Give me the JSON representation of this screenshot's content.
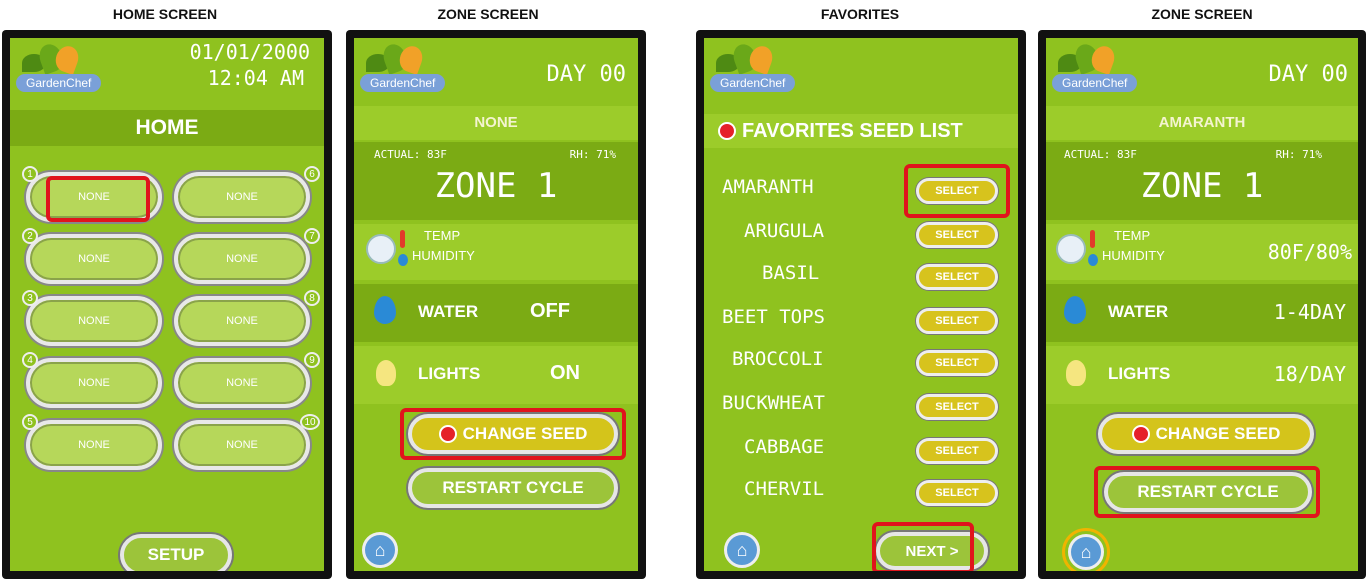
{
  "captions": [
    "HOME SCREEN",
    "ZONE SCREEN",
    "FAVORITES",
    "ZONE SCREEN"
  ],
  "brand": "GardenChef",
  "home": {
    "date": "01/01/2000",
    "time": "12:04 AM",
    "title": "HOME",
    "slots": [
      {
        "num": "1",
        "label": "NONE"
      },
      {
        "num": "6",
        "label": "NONE"
      },
      {
        "num": "2",
        "label": "NONE"
      },
      {
        "num": "7",
        "label": "NONE"
      },
      {
        "num": "3",
        "label": "NONE"
      },
      {
        "num": "8",
        "label": "NONE"
      },
      {
        "num": "4",
        "label": "NONE"
      },
      {
        "num": "9",
        "label": "NONE"
      },
      {
        "num": "5",
        "label": "NONE"
      },
      {
        "num": "10",
        "label": "NONE"
      }
    ],
    "setup": "SETUP"
  },
  "zone1": {
    "day": "DAY 00",
    "seed": "NONE",
    "actual": "ACTUAL: 83F",
    "rh": "RH: 71%",
    "zone": "ZONE 1",
    "temp_label": "TEMP",
    "humidity_label": "HUMIDITY",
    "temp_humidity_value": "",
    "water_label": "WATER",
    "water_value": "OFF",
    "lights_label": "LIGHTS",
    "lights_value": "ON",
    "change_seed": "CHANGE SEED",
    "restart_cycle": "RESTART CYCLE"
  },
  "favorites": {
    "title": "FAVORITES SEED LIST",
    "seeds": [
      "AMARANTH",
      "ARUGULA",
      "BASIL",
      "BEET TOPS",
      "BROCCOLI",
      "BUCKWHEAT",
      "CABBAGE",
      "CHERVIL"
    ],
    "select_label": "SELECT",
    "next": "NEXT >"
  },
  "zone2": {
    "day": "DAY 00",
    "seed": "AMARANTH",
    "actual": "ACTUAL: 83F",
    "rh": "RH: 71%",
    "zone": "ZONE 1",
    "temp_label": "TEMP",
    "humidity_label": "HUMIDITY",
    "temp_humidity_value": "80F/80%",
    "water_label": "WATER",
    "water_value": "1-4DAY",
    "lights_label": "LIGHTS",
    "lights_value": "18/DAY",
    "change_seed": "CHANGE SEED",
    "restart_cycle": "RESTART CYCLE"
  },
  "colors": {
    "highlight": "#e0141c",
    "home_highlight": "#f0b400",
    "screen": "#8fc21f"
  }
}
